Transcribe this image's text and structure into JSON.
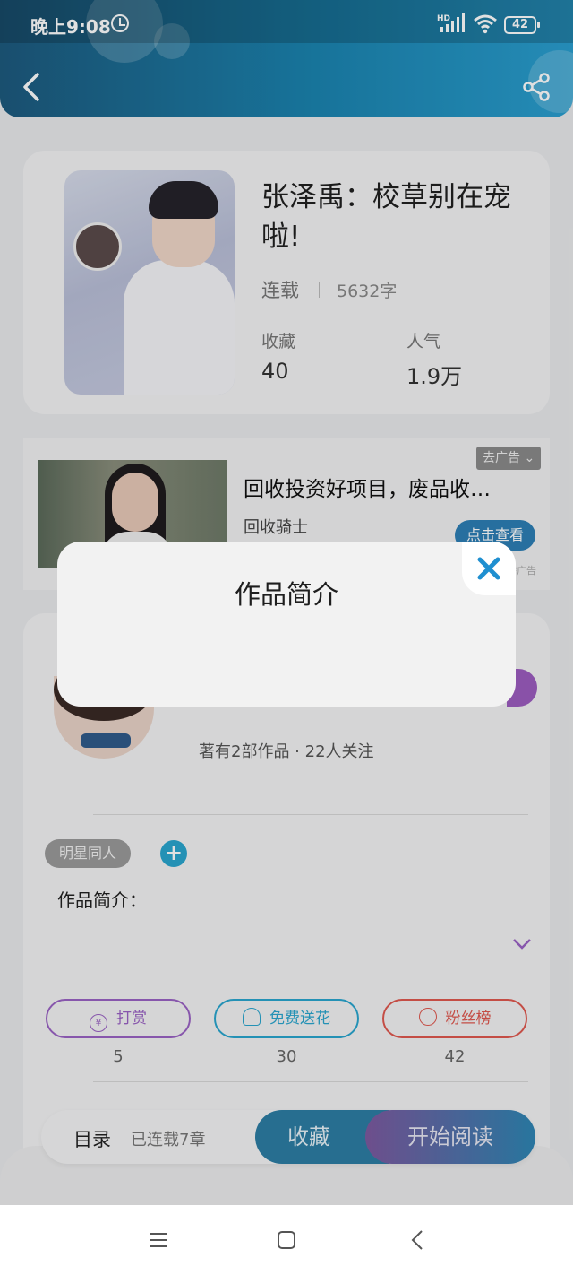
{
  "status_bar": {
    "time": "晚上9:08",
    "battery": "42",
    "network": "HD"
  },
  "book": {
    "title": "张泽禹：校草别在宠啦!",
    "status": "连载",
    "word_count": "5632字",
    "stats": [
      {
        "label": "收藏",
        "value": "40"
      },
      {
        "label": "人气",
        "value": "1.9万"
      }
    ]
  },
  "ad": {
    "remove_label": "去广告",
    "title": "回收投资好项目，废品收…",
    "source": "回收骑士",
    "button": "点击查看",
    "mark": "腾广告"
  },
  "author": {
    "meta": "著有2部作品 · 22人关注",
    "tag": "明星同人",
    "intro_label": "作品简介：",
    "actions": [
      {
        "label": "打赏",
        "icon": "yen-icon",
        "count": "5",
        "color": "#9a62c4"
      },
      {
        "label": "免费送花",
        "icon": "flower-icon",
        "count": "30",
        "color": "#2aa6cf"
      },
      {
        "label": "粉丝榜",
        "icon": "fans-icon",
        "count": "42",
        "color": "#e0584f"
      }
    ]
  },
  "bottom_bar": {
    "toc": "目录",
    "toc_count": "已连载7章",
    "collect": "收藏",
    "read": "开始阅读"
  },
  "dialog": {
    "title": "作品简介"
  },
  "colors": {
    "header": "#1b84b0",
    "accent": "#2aa6cf",
    "purple": "#9d5dc0"
  }
}
